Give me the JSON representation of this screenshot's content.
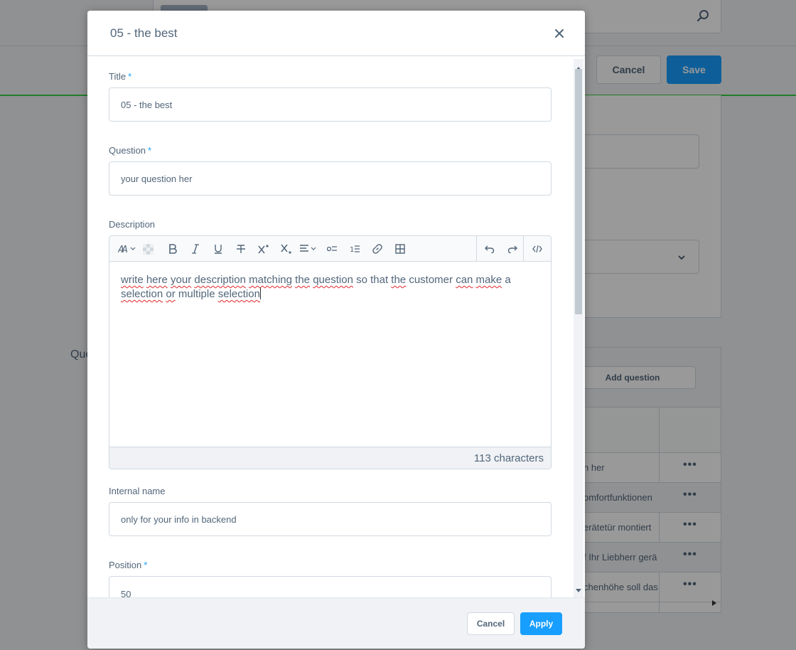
{
  "background": {
    "cancel_label": "Cancel",
    "save_label": "Save",
    "section_label": "Que",
    "add_question_label": "Add question",
    "rows": [
      {
        "text": "n her"
      },
      {
        "text": "omfortfunktionen"
      },
      {
        "text": "erätetür montiert"
      },
      {
        "text": "f Ihr Liebherr gerä"
      },
      {
        "text": "chenhöhe soll das"
      }
    ]
  },
  "modal": {
    "title": "05 - the best",
    "fields": {
      "title": {
        "label": "Title",
        "required": "*",
        "value": "05 - the best"
      },
      "question": {
        "label": "Question",
        "required": "*",
        "value": "your question her"
      },
      "description": {
        "label": "Description",
        "content_words": [
          {
            "t": "write",
            "spell": true
          },
          {
            "t": " "
          },
          {
            "t": "here",
            "spell": true
          },
          {
            "t": " "
          },
          {
            "t": "your",
            "spell": true
          },
          {
            "t": " "
          },
          {
            "t": "description",
            "spell": true
          },
          {
            "t": " "
          },
          {
            "t": "matching",
            "spell": true
          },
          {
            "t": " "
          },
          {
            "t": "the",
            "spell": true
          },
          {
            "t": " "
          },
          {
            "t": "question",
            "spell": true
          },
          {
            "t": " so that "
          },
          {
            "t": "the",
            "spell": true
          },
          {
            "t": " customer "
          },
          {
            "t": "can",
            "spell": true
          },
          {
            "t": " "
          },
          {
            "t": "make",
            "spell": true
          },
          {
            "t": " a "
          },
          {
            "t": "selection",
            "spell": true
          },
          {
            "t": " "
          },
          {
            "t": "or",
            "spell": true
          },
          {
            "t": " multiple "
          },
          {
            "t": "selection",
            "spell": true
          }
        ],
        "char_count": "113 characters"
      },
      "internal_name": {
        "label": "Internal name",
        "value": "only for your info in backend"
      },
      "position": {
        "label": "Position",
        "required": "*",
        "value": "50"
      }
    },
    "cancel_label": "Cancel",
    "apply_label": "Apply"
  },
  "colors": {
    "primary": "#189eff",
    "text": "#52667a",
    "border": "#d1d9e0",
    "success": "#37d046"
  }
}
